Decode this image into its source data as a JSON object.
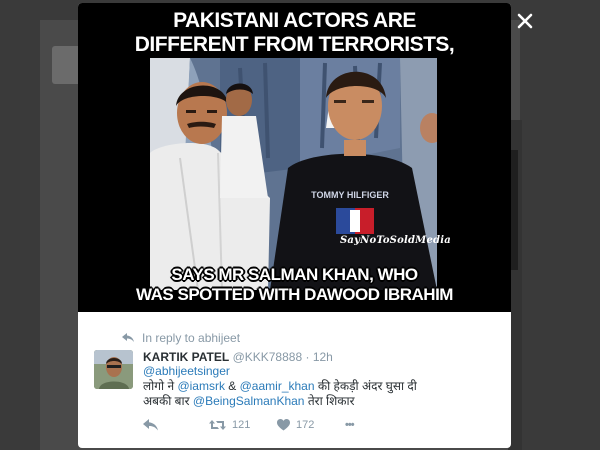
{
  "overlay": {
    "close_icon": "close-icon"
  },
  "media": {
    "caption_top_line1": "PAKISTANI ACTORS ARE",
    "caption_top_line2": "DIFFERENT FROM TERRORISTS,",
    "caption_bottom_line1": "SAYS MR SALMAN KHAN, WHO",
    "caption_bottom_line2": "WAS SPOTTED WITH DAWOOD IBRAHIM",
    "watermark": "SayNoToSoldMedia",
    "shirt_text": "TOMMY HILFIGER"
  },
  "tweet": {
    "reply_context": "In reply to abhijeet",
    "author_name": "KARTIK PATEL",
    "author_handle": "@KKK78888",
    "separator": "·",
    "time": "12h",
    "mention_1": "@abhijeetsinger",
    "line2_part1": "लोगो ने ",
    "mention_2": "@iamsrk",
    "line2_amp": " & ",
    "mention_3": "@aamir_khan",
    "line2_part2": " की हेकड़ी अंदर घुसा दी",
    "line3_part1": "अबकी बार ",
    "mention_4": "@BeingSalmanKhan",
    "line3_part2": " तेरा शिकार",
    "retweet_count": "121",
    "like_count": "172",
    "more_label": "•••"
  },
  "colors": {
    "accent_link": "#2b7bb9",
    "muted": "#8899a6",
    "text": "#292f33"
  }
}
